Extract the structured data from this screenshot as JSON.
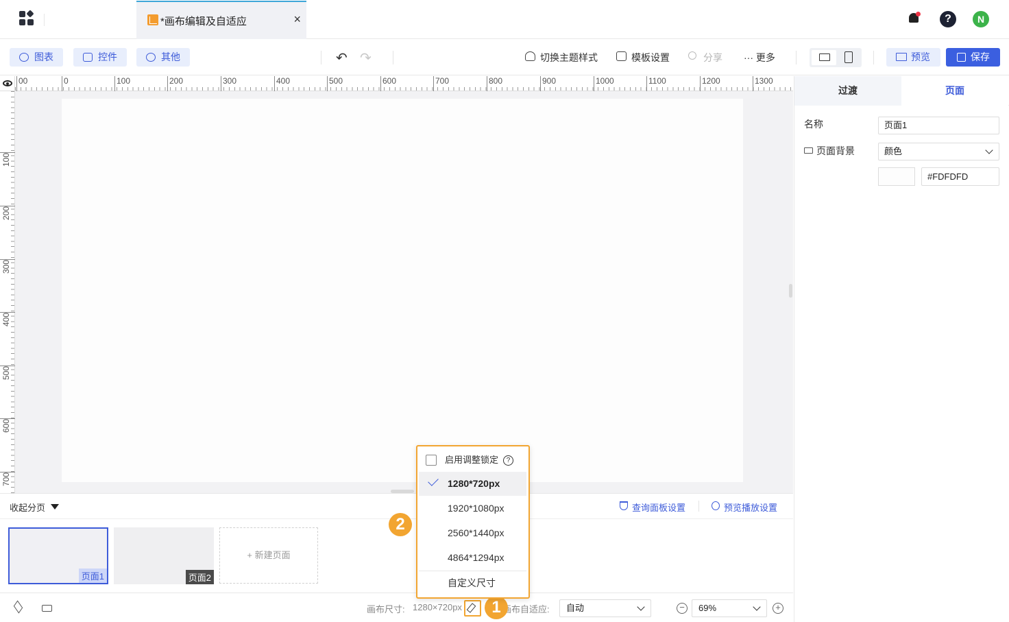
{
  "titlebar": {
    "tab_title": "*画布编辑及自适应",
    "tab_close": "×",
    "help": "?",
    "avatar": "N"
  },
  "toolbar": {
    "chart_label": "图表",
    "widget_label": "控件",
    "other_label": "其他",
    "theme_label": "切换主题样式",
    "template_label": "模板设置",
    "share_label": "分享",
    "more_label": "··· 更多",
    "preview_label": "预览",
    "save_label": "保存"
  },
  "ruler": {
    "h_ticks": [
      "00",
      "0",
      "100",
      "200",
      "300",
      "400",
      "500",
      "600",
      "700",
      "800",
      "900",
      "1000",
      "1100",
      "1200",
      "1300"
    ],
    "v_ticks": [
      "100",
      "200",
      "300",
      "400",
      "500",
      "600",
      "700"
    ]
  },
  "right_panel": {
    "tabs": [
      "过渡",
      "页面"
    ],
    "name_label": "名称",
    "name_value": "页面1",
    "bg_label": "页面背景",
    "bg_type": "颜色",
    "bg_color": "#FDFDFD"
  },
  "pagebar": {
    "collapse_label": "收起分页",
    "query_panel_label": "查询面板设置",
    "preview_play_label": "预览播放设置",
    "pages": [
      "页面1",
      "页面2"
    ],
    "new_page_label": "+ 新建页面"
  },
  "statusbar": {
    "canvas_size_label": "画布尺寸:",
    "canvas_size_value": "1280×720px",
    "adapt_label": "画布自适应:",
    "adapt_value": "自动",
    "zoom_value": "69%"
  },
  "popup": {
    "lock_label": "启用调整锁定",
    "sizes": [
      "1280*720px",
      "1920*1080px",
      "2560*1440px",
      "4864*1294px"
    ],
    "selected_index": 0,
    "custom_label": "自定义尺寸"
  },
  "badges": [
    "1",
    "2"
  ],
  "colors": {
    "accent": "#3d5bd9",
    "save_button": "#3b5fe0",
    "highlight": "#f2a531",
    "avatar": "#3cb34a"
  }
}
